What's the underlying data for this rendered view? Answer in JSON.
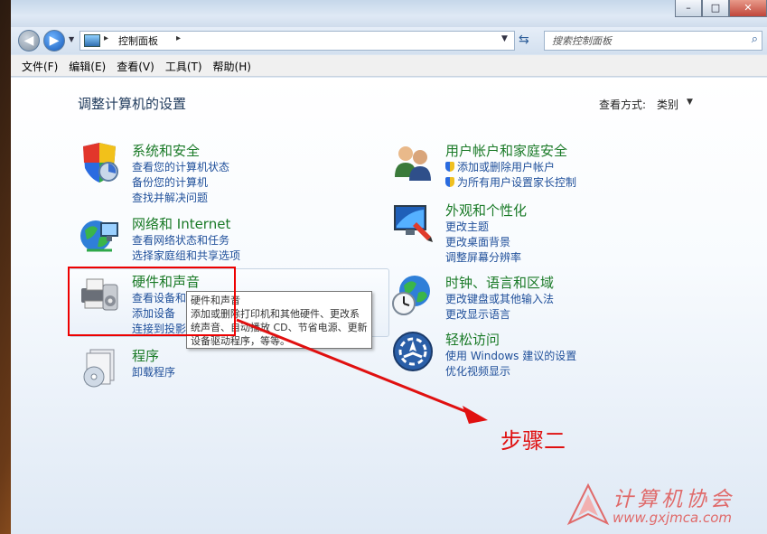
{
  "address": {
    "location": "控制面板"
  },
  "search": {
    "placeholder": "搜索控制面板"
  },
  "menu": [
    "文件(F)",
    "编辑(E)",
    "查看(V)",
    "工具(T)",
    "帮助(H)"
  ],
  "page": {
    "title": "调整计算机的设置",
    "view_by_label": "查看方式:",
    "view_by_value": "类别"
  },
  "categories": {
    "system": {
      "title": "系统和安全",
      "links": [
        "查看您的计算机状态",
        "备份您的计算机",
        "查找并解决问题"
      ]
    },
    "network": {
      "title": "网络和 Internet",
      "links": [
        "查看网络状态和任务",
        "选择家庭组和共享选项"
      ]
    },
    "hardware": {
      "title": "硬件和声音",
      "links": [
        "查看设备和打印机",
        "添加设备",
        "连接到投影仪"
      ]
    },
    "programs": {
      "title": "程序",
      "links": [
        "卸载程序"
      ]
    },
    "accounts": {
      "title": "用户帐户和家庭安全",
      "links": [
        "添加或删除用户帐户",
        "为所有用户设置家长控制"
      ]
    },
    "appearance": {
      "title": "外观和个性化",
      "links": [
        "更改主题",
        "更改桌面背景",
        "调整屏幕分辨率"
      ]
    },
    "clock": {
      "title": "时钟、语言和区域",
      "links": [
        "更改键盘或其他输入法",
        "更改显示语言"
      ]
    },
    "ease": {
      "title": "轻松访问",
      "links": [
        "使用 Windows 建议的设置",
        "优化视频显示"
      ]
    }
  },
  "tooltip": {
    "title": "硬件和声音",
    "body": "添加或删除打印机和其他硬件、更改系统声音、自动播放 CD、节省电源、更新设备驱动程序，等等。"
  },
  "annotation": {
    "step": "步骤二"
  },
  "watermark": {
    "title": "计算机协会",
    "url": "www.gxjmca.com"
  },
  "colors": {
    "category_title": "#1a7a27",
    "link": "#1f4f9a",
    "annotation_red": "#e01010"
  }
}
